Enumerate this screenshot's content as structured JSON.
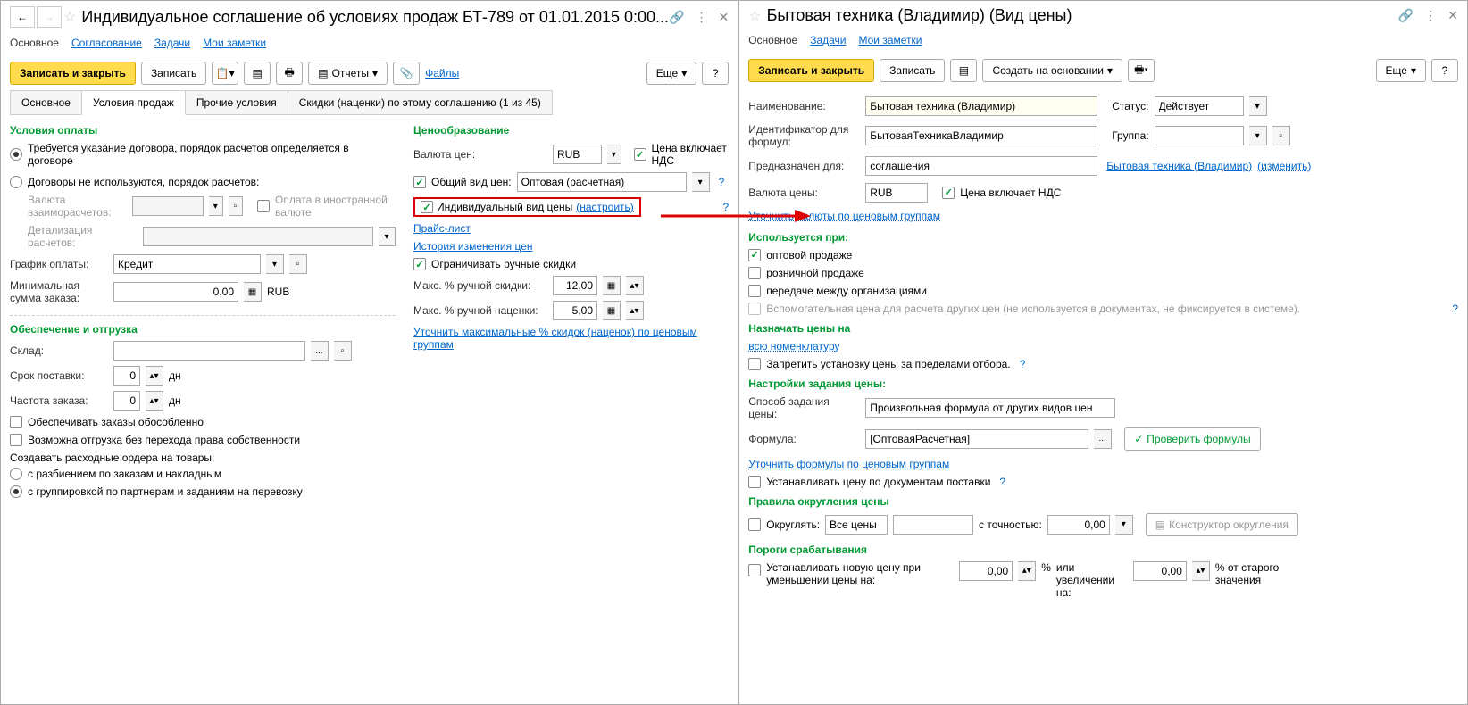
{
  "left": {
    "title": "Индивидуальное соглашение об условиях продаж БТ-789 от 01.01.2015 0:00...",
    "subnav": [
      "Основное",
      "Согласование",
      "Задачи",
      "Мои заметки"
    ],
    "toolbar": {
      "save_close": "Записать и закрыть",
      "save": "Записать",
      "reports": "Отчеты",
      "files": "Файлы",
      "more": "Еще"
    },
    "tabs": [
      "Основное",
      "Условия продаж",
      "Прочие условия",
      "Скидки (наценки) по этому соглашению (1 из 45)"
    ],
    "payment": {
      "title": "Условия оплаты",
      "opt1": "Требуется указание договора, порядок расчетов определяется в договоре",
      "opt2": "Договоры не используются, порядок расчетов:",
      "currency_label": "Валюта взаиморасчетов:",
      "foreign": "Оплата в иностранной валюте",
      "detail_label": "Детализация расчетов:",
      "schedule_label": "График оплаты:",
      "schedule_value": "Кредит",
      "min_sum_label": "Минимальная сумма заказа:",
      "min_sum_value": "0,00",
      "min_sum_cur": "RUB"
    },
    "shipping": {
      "title": "Обеспечение и отгрузка",
      "warehouse": "Склад:",
      "delivery_time": "Срок поставки:",
      "delivery_value": "0",
      "days": "дн",
      "order_freq": "Частота заказа:",
      "order_freq_value": "0",
      "provide": "Обеспечивать заказы обособленно",
      "ship_without": "Возможна отгрузка без перехода права собственности",
      "create_orders": "Создавать расходные ордера на товары:",
      "o1": "с разбиением по заказам и накладным",
      "o2": "с группировкой по партнерам и заданиям на перевозку"
    },
    "pricing": {
      "title": "Ценообразование",
      "cur_label": "Валюта цен:",
      "cur_value": "RUB",
      "price_vat": "Цена включает НДС",
      "common_type": "Общий вид цен:",
      "common_value": "Оптовая (расчетная)",
      "individual": "Индивидуальный вид цены",
      "configure": "(настроить)",
      "price_list": "Прайс-лист",
      "history": "История изменения цен",
      "limit_manual": "Ограничивать ручные скидки",
      "max_discount": "Макс. % ручной скидки:",
      "max_discount_v": "12,00",
      "max_markup": "Макс. % ручной наценки:",
      "max_markup_v": "5,00",
      "clarify": "Уточнить максимальные % скидок (наценок) по ценовым группам"
    }
  },
  "right": {
    "title": "Бытовая техника (Владимир) (Вид цены)",
    "subnav": [
      "Основное",
      "Задачи",
      "Мои заметки"
    ],
    "toolbar": {
      "save_close": "Записать и закрыть",
      "save": "Записать",
      "create_based": "Создать на основании",
      "more": "Еще"
    },
    "name_label": "Наименование:",
    "name_value": "Бытовая техника (Владимир)",
    "status_label": "Статус:",
    "status_value": "Действует",
    "id_label": "Идентификатор для формул:",
    "id_value": "БытоваяТехникаВладимир",
    "group_label": "Группа:",
    "for_label": "Предназначен для:",
    "for_value": "соглашения",
    "for_link": "Бытовая техника (Владимир)",
    "change_link": "(изменить)",
    "price_cur_label": "Валюта цены:",
    "price_cur_value": "RUB",
    "price_vat": "Цена включает НДС",
    "clarify_cur": "Уточнить валюты по ценовым группам",
    "used_title": "Используется при:",
    "used1": "оптовой продаже",
    "used2": "розничной продаже",
    "used3": "передаче между организациями",
    "used4": "Вспомогательная цена для расчета других цен (не используется в документах, не фиксируется в системе).",
    "assign_title": "Назначать цены на",
    "all_nomenclature": "всю номенклатуру",
    "prohibit": "Запретить установку цены за пределами отбора.",
    "settings_title": "Настройки задания цены:",
    "method_label": "Способ задания цены:",
    "method_value": "Произвольная формула от других видов цен",
    "formula_label": "Формула:",
    "formula_value": "[ОптоваяРасчетная]",
    "check_formula": "Проверить формулы",
    "clarify_formula": "Уточнить формулы по ценовым группам",
    "set_by_docs": "Устанавливать цену по документам поставки",
    "rounding_title": "Правила округления цены",
    "round": "Округлять:",
    "round_value": "Все цены",
    "precision_label": "с точностью:",
    "precision_value": "0,00",
    "rounding_designer": "Конструктор округления",
    "thresholds_title": "Пороги срабатывания",
    "threshold_text1": "Устанавливать новую цену при уменьшении цены на:",
    "threshold_v1": "0,00",
    "pct": "%",
    "or_incr": "или увеличении на:",
    "threshold_v2": "0,00",
    "from_old": "% от старого значения"
  }
}
